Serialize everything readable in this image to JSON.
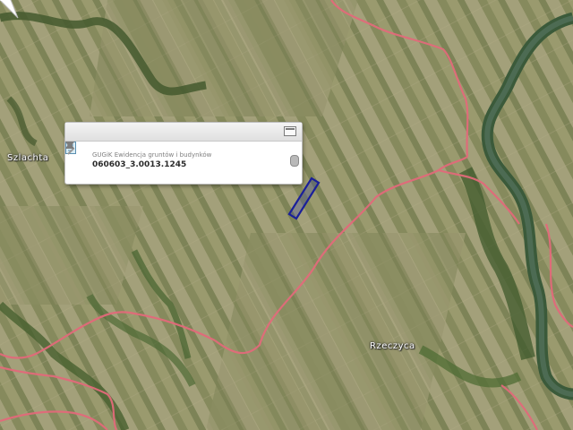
{
  "map": {
    "place_labels": {
      "left": "Szlachta",
      "right": "Rzeczyca"
    },
    "colors": {
      "boundary_line": "#e26a7a",
      "selected_parcel": "#1a1f9a",
      "river": "#3b5a3a"
    }
  },
  "popup": {
    "maximize_icon": "maximize-icon",
    "result": {
      "icon": "document-icon",
      "title": "GUGiK Ewidencja gruntów i budynków",
      "parcel_id": "060603_3.0013.1245",
      "open_icon": "chevron-right-icon"
    },
    "navigation": {
      "up_icon": "arrow-up-icon",
      "down_icon": "arrow-down-icon"
    }
  }
}
